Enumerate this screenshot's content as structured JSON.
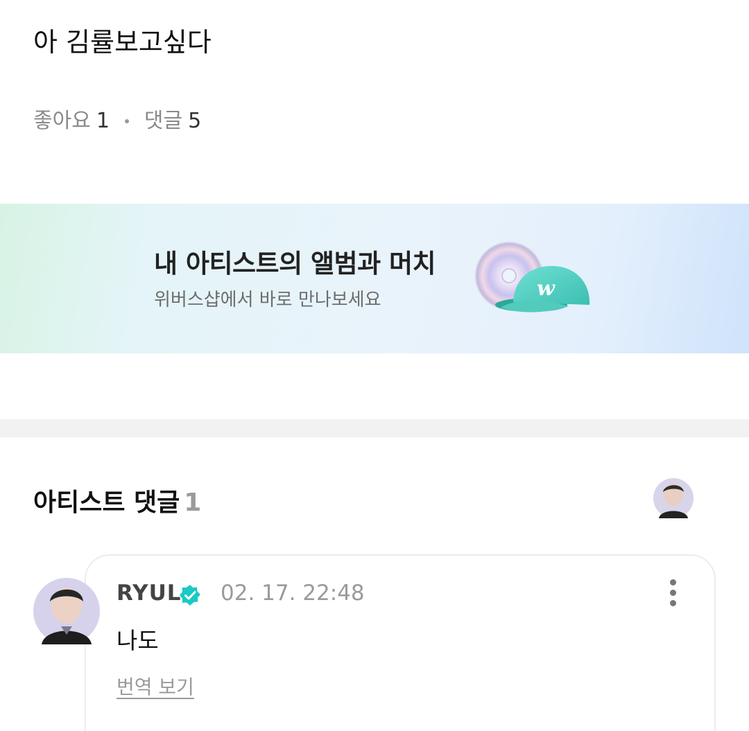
{
  "post": {
    "text": "아 김률보고싶다",
    "likes_label": "좋아요",
    "likes_count": "1",
    "comments_label": "댓글",
    "comments_count": "5"
  },
  "banner": {
    "title": "내 아티스트의 앨범과 머치",
    "subtitle": "위버스샵에서 바로 만나보세요",
    "icons": [
      "cd-icon",
      "cap-icon"
    ],
    "cap_color": "#4fcfc0"
  },
  "artist_comments": {
    "title": "아티스트 댓글",
    "count": "1",
    "items": [
      {
        "author": "RYUL",
        "verified": true,
        "time": "02. 17. 22:48",
        "body": "나도",
        "translate_label": "번역 보기"
      }
    ]
  },
  "colors": {
    "verified": "#1cc9c4",
    "muted_text": "#9a9a9a",
    "divider": "#f2f2f2"
  }
}
